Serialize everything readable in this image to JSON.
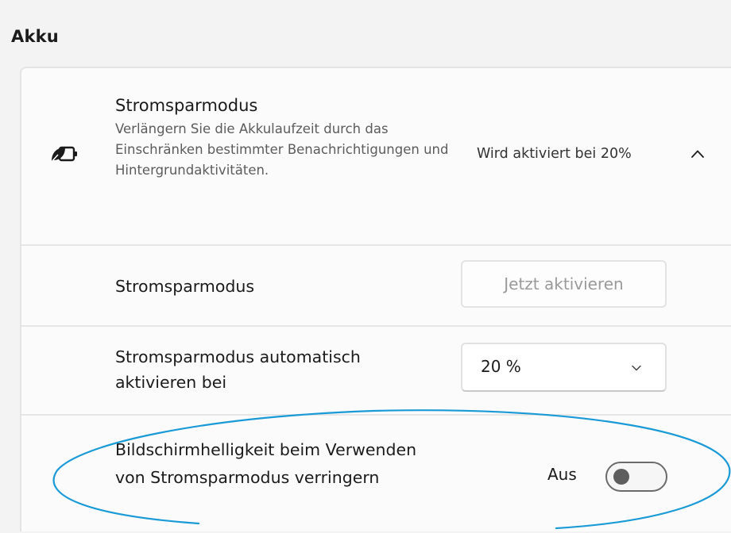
{
  "section": {
    "title": "Akku"
  },
  "battery_saver": {
    "icon": "battery-saver-leaf-icon",
    "title": "Stromsparmodus",
    "description": "Verlängern Sie die Akkulaufzeit durch das Einschränken bestimmter Benachrichtigungen und Hintergrundaktivitäten.",
    "status": "Wird aktiviert bei 20%",
    "expand_icon": "chevron-up-icon"
  },
  "rows": {
    "activate_now": {
      "label": "Stromsparmodus",
      "button_label": "Jetzt aktivieren"
    },
    "auto_activate": {
      "label": "Stromsparmodus automatisch aktivieren bei",
      "selected_value": "20 %",
      "dropdown_icon": "chevron-down-icon"
    },
    "lower_brightness": {
      "label": "Bildschirmhelligkeit beim Verwenden von Stromsparmodus verringern",
      "state_label": "Aus",
      "toggle_on": false
    }
  },
  "colors": {
    "annotation_ellipse": "#1a9ad6",
    "background": "#f3f3f3",
    "panel": "#fbfbfb",
    "toggle_knob": "#5e5e5e"
  }
}
